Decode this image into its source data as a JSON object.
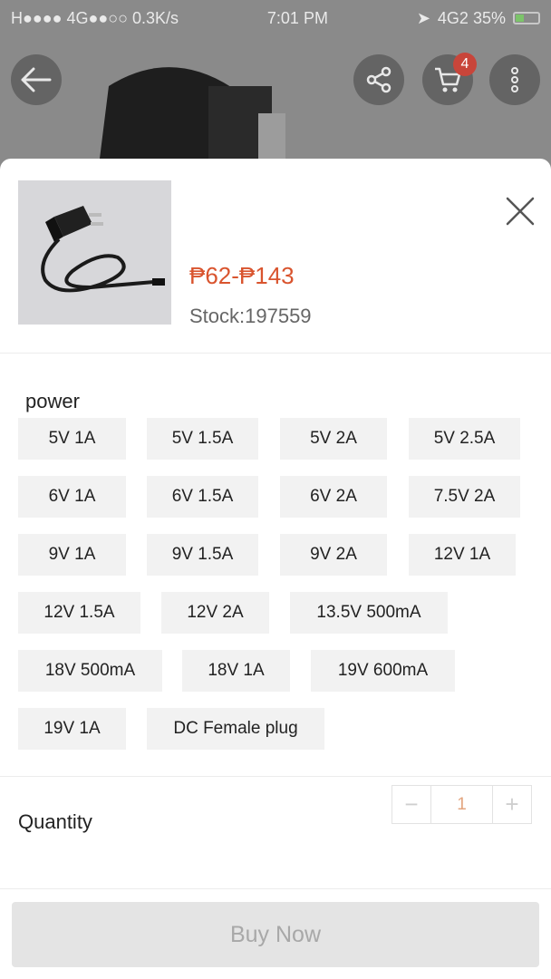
{
  "status_bar": {
    "left": "H●●●● 4G●●○○ 0.3K/s",
    "time": "7:01 PM",
    "right": "4G2 35%"
  },
  "nav": {
    "cart_count": "4"
  },
  "product": {
    "price": "₱62-₱143",
    "stock": "Stock:197559"
  },
  "options": {
    "title": "power",
    "items": [
      "5V 1A",
      "5V 1.5A",
      "5V 2A",
      "5V 2.5A",
      "6V 1A",
      "6V 1.5A",
      "6V 2A",
      "7.5V 2A",
      "9V 1A",
      "9V 1.5A",
      "9V 2A",
      "12V 1A",
      "12V 1.5A",
      "12V 2A",
      "13.5V 500mA",
      "18V 500mA",
      "18V 1A",
      "19V 600mA",
      "19V 1A",
      "DC Female plug"
    ]
  },
  "quantity": {
    "label": "Quantity",
    "minus": "−",
    "value": "1",
    "plus": "+"
  },
  "buy_button": "Buy Now",
  "colors": {
    "price": "#d9542e",
    "badge": "#c8453a"
  }
}
